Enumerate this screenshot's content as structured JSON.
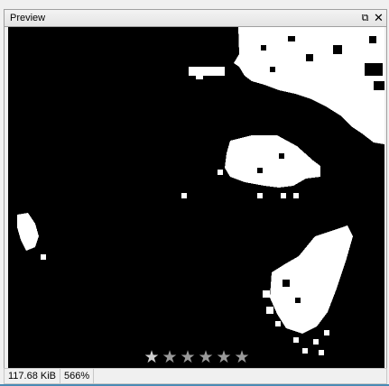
{
  "window": {
    "title": "Preview"
  },
  "titlebar_buttons": {
    "float_icon": "⧉",
    "close_icon": "✕"
  },
  "status": {
    "file_size": "117.68 KiB",
    "zoom": "566%"
  },
  "rating": {
    "stars": [
      "★",
      "★",
      "★",
      "★",
      "★",
      "★"
    ],
    "value": 0
  },
  "colors": {
    "background": "#000000",
    "foreground": "#ffffff",
    "accent": "#4a8ab4"
  }
}
